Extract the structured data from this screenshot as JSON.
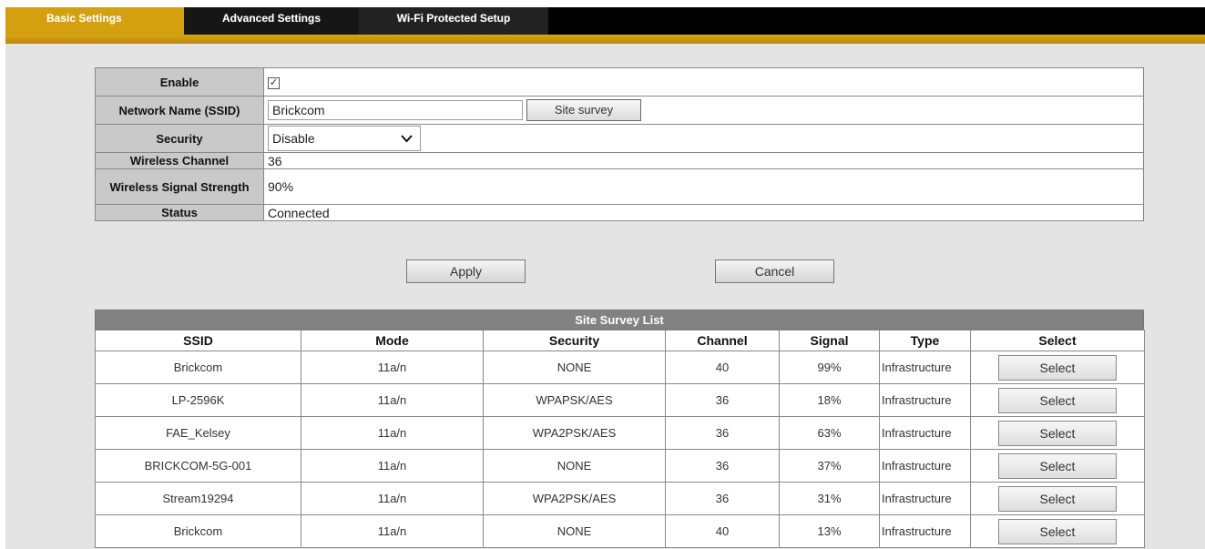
{
  "tabs": [
    {
      "label": "Basic Settings",
      "active": true
    },
    {
      "label": "Advanced Settings",
      "active": false
    },
    {
      "label": "Wi-Fi Protected Setup",
      "active": false
    }
  ],
  "settings": {
    "enable_label": "Enable",
    "enable_checked": true,
    "check_glyph": "✓",
    "ssid_label": "Network Name (SSID)",
    "ssid_value": "Brickcom",
    "site_survey_button": "Site survey",
    "security_label": "Security",
    "security_value": "Disable",
    "channel_label": "Wireless Channel",
    "channel_value": "36",
    "signal_label": "Wireless Signal Strength",
    "signal_value": "90%",
    "status_label": "Status",
    "status_value": "Connected"
  },
  "actions": {
    "apply": "Apply",
    "cancel": "Cancel"
  },
  "survey": {
    "title": "Site Survey List",
    "columns": [
      "SSID",
      "Mode",
      "Security",
      "Channel",
      "Signal",
      "Type",
      "Select"
    ],
    "select_label": "Select",
    "rows": [
      {
        "ssid": "Brickcom",
        "mode": "11a/n",
        "security": "NONE",
        "channel": "40",
        "signal": "99%",
        "type": "Infrastructure"
      },
      {
        "ssid": "LP-2596K",
        "mode": "11a/n",
        "security": "WPAPSK/AES",
        "channel": "36",
        "signal": "18%",
        "type": "Infrastructure"
      },
      {
        "ssid": "FAE_Kelsey",
        "mode": "11a/n",
        "security": "WPA2PSK/AES",
        "channel": "36",
        "signal": "63%",
        "type": "Infrastructure"
      },
      {
        "ssid": "BRICKCOM-5G-001",
        "mode": "11a/n",
        "security": "NONE",
        "channel": "36",
        "signal": "37%",
        "type": "Infrastructure"
      },
      {
        "ssid": "Stream19294",
        "mode": "11a/n",
        "security": "WPA2PSK/AES",
        "channel": "36",
        "signal": "31%",
        "type": "Infrastructure"
      },
      {
        "ssid": "Brickcom",
        "mode": "11a/n",
        "security": "NONE",
        "channel": "40",
        "signal": "13%",
        "type": "Infrastructure"
      }
    ]
  },
  "colors": {
    "accent_gold": "#d4a010",
    "tabbar_black": "#000000",
    "header_gray": "#828282",
    "label_gray": "#c9c9c9"
  }
}
